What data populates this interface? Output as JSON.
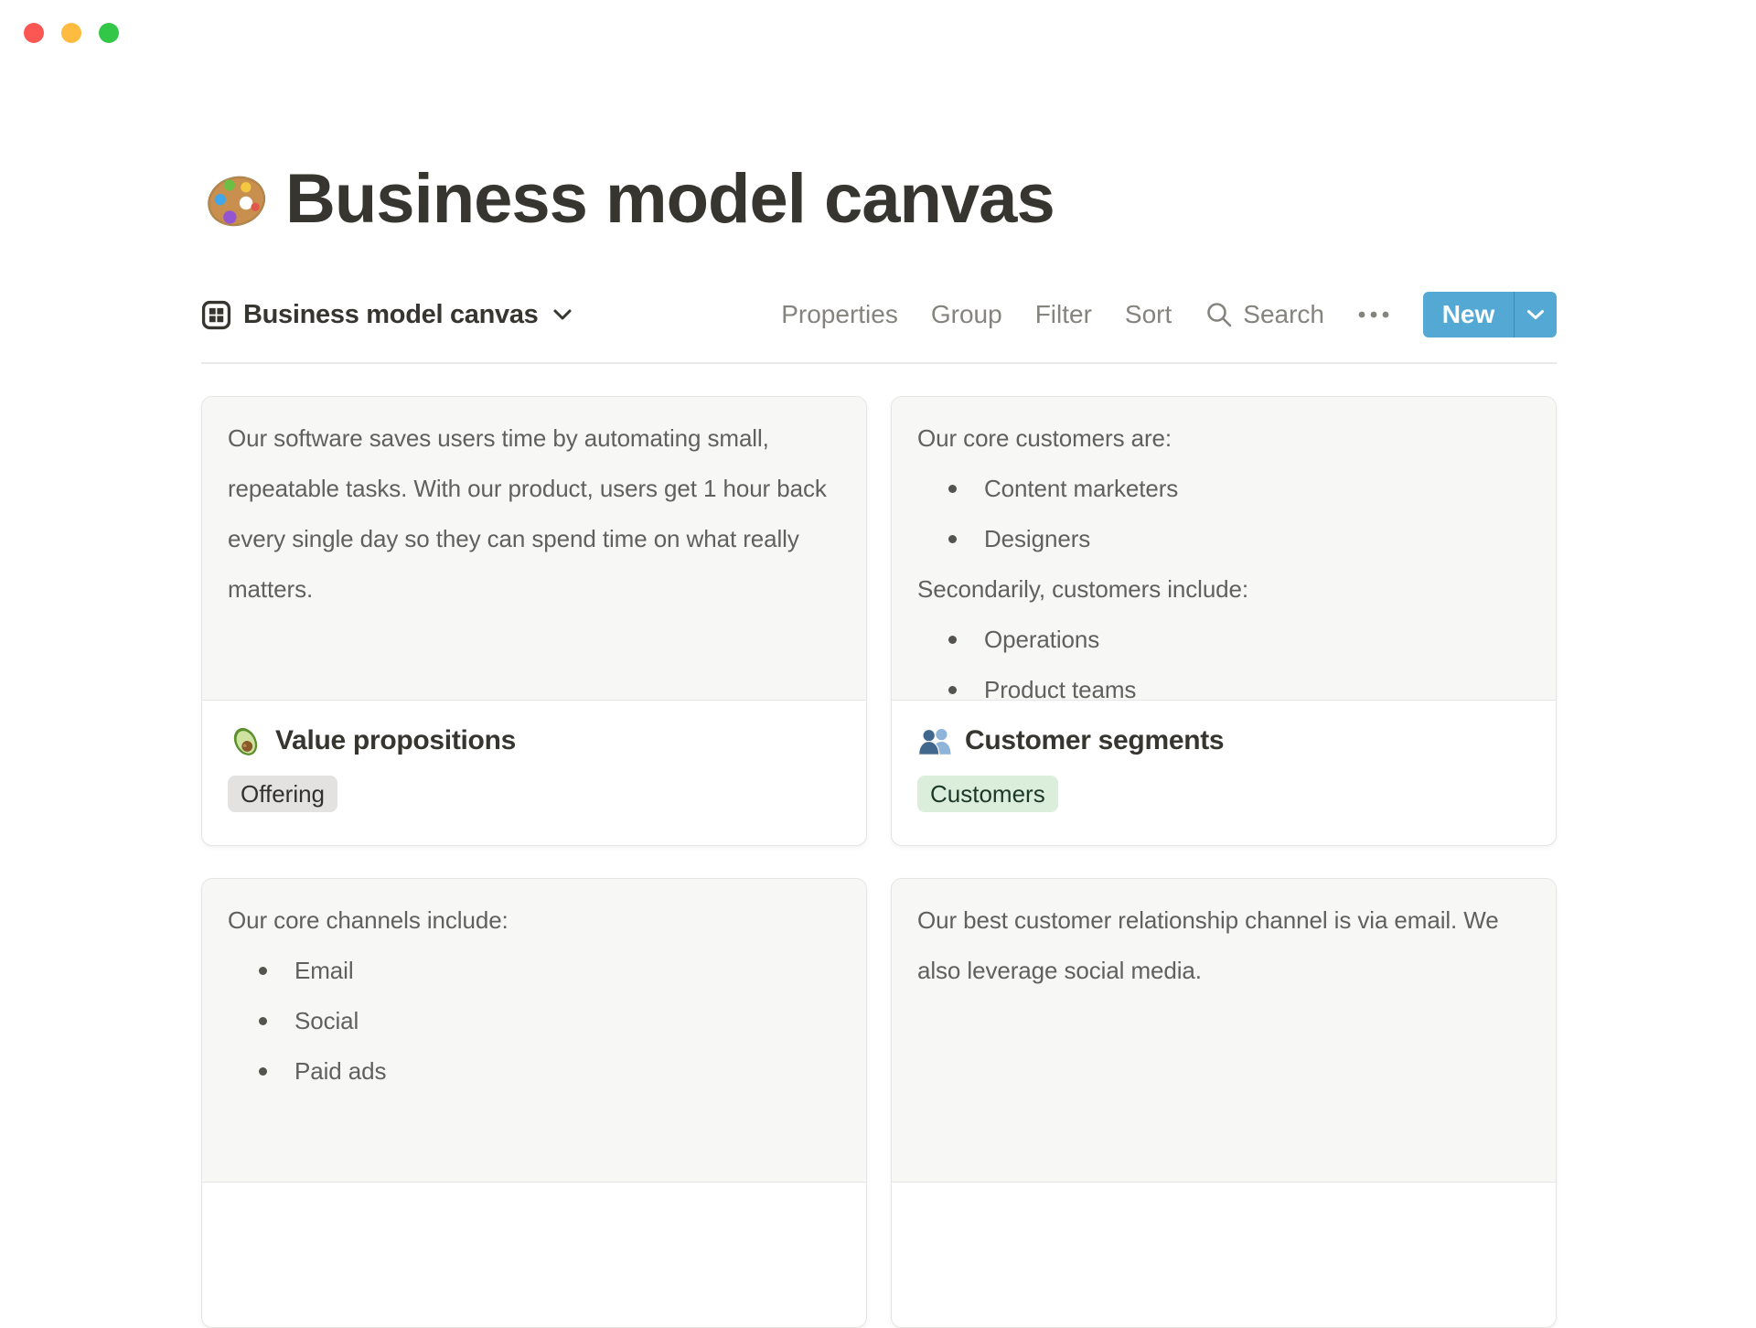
{
  "window": {
    "controls": [
      {
        "name": "close",
        "color": "#FC5753"
      },
      {
        "name": "minimize",
        "color": "#FDBC40"
      },
      {
        "name": "zoom",
        "color": "#33C748"
      }
    ]
  },
  "page": {
    "title": "Business model canvas",
    "title_icon": "palette-icon"
  },
  "view_bar": {
    "view": {
      "icon": "gallery-view-icon",
      "label": "Business model canvas"
    },
    "actions": {
      "properties": "Properties",
      "group": "Group",
      "filter": "Filter",
      "sort": "Sort",
      "search": "Search",
      "new": "New"
    },
    "new_button_color": "#53A8D4"
  },
  "cards": [
    {
      "blocks": [
        {
          "type": "p",
          "text": "Our software saves users time by automating small,"
        },
        {
          "type": "p",
          "text": "repeatable tasks. With our product, users get 1 hour back"
        },
        {
          "type": "p",
          "text": "every single day so they can spend time on what really"
        },
        {
          "type": "p",
          "text": "matters."
        }
      ],
      "footer": {
        "icon": "avocado-icon",
        "title": "Value propositions",
        "tag": {
          "label": "Offering",
          "bg": "#E3E2E0",
          "fg": "#32302C"
        }
      }
    },
    {
      "blocks": [
        {
          "type": "p",
          "text": "Our core customers are:"
        },
        {
          "type": "li",
          "text": "Content marketers"
        },
        {
          "type": "li",
          "text": "Designers"
        },
        {
          "type": "p",
          "text": "Secondarily, customers include:"
        },
        {
          "type": "li",
          "text": "Operations"
        },
        {
          "type": "li",
          "text": "Product teams"
        }
      ],
      "footer": {
        "icon": "busts-icon",
        "title": "Customer segments",
        "tag": {
          "label": "Customers",
          "bg": "#DBEDDB",
          "fg": "#1C3829"
        }
      }
    },
    {
      "blocks": [
        {
          "type": "p",
          "text": "Our core channels include:"
        },
        {
          "type": "li",
          "text": "Email"
        },
        {
          "type": "li",
          "text": "Social"
        },
        {
          "type": "li",
          "text": "Paid ads"
        }
      ]
    },
    {
      "blocks": [
        {
          "type": "p",
          "text": "Our best customer relationship channel is via email. We"
        },
        {
          "type": "p",
          "text": "also leverage social media."
        }
      ]
    }
  ]
}
